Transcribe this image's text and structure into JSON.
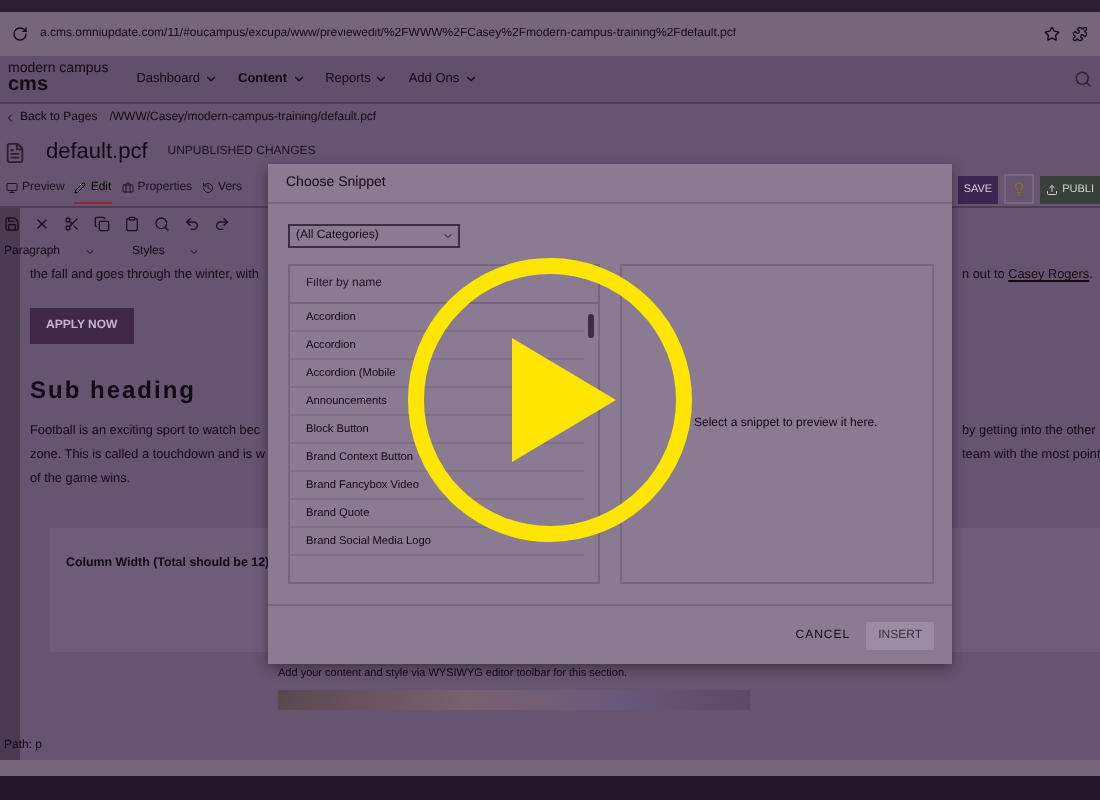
{
  "browser": {
    "url": "a.cms.omniupdate.com/11/#oucampus/excupa/www/previewedit/%2FWWW%2FCasey%2Fmodern-campus-training%2Fdefault.pcf"
  },
  "header": {
    "logo_top": "modern campus",
    "logo_bottom": "cms",
    "nav": [
      {
        "label": "Dashboard",
        "selected": false
      },
      {
        "label": "Content",
        "selected": true
      },
      {
        "label": "Reports",
        "selected": false
      },
      {
        "label": "Add Ons",
        "selected": false
      }
    ]
  },
  "breadcrumb": {
    "back": "Back to Pages",
    "path": "/WWW/Casey/modern-campus-training/default.pcf"
  },
  "page": {
    "title": "default.pcf",
    "status": "UNPUBLISHED CHANGES"
  },
  "tabs": [
    {
      "label": "Preview",
      "kind": "preview",
      "selected": false
    },
    {
      "label": "Edit",
      "kind": "edit",
      "selected": true
    },
    {
      "label": "Properties",
      "kind": "properties",
      "selected": false
    },
    {
      "label": "Vers",
      "kind": "versions",
      "selected": false
    }
  ],
  "actions": {
    "save": "SAVE",
    "publish": "PUBLI"
  },
  "format": {
    "block": "Paragraph",
    "styles": "Styles"
  },
  "content": {
    "line_1": "the fall and goes through the winter, with",
    "line_1_right": {
      "text": "n out to ",
      "link": "Casey Rogers",
      "after": "."
    },
    "button": "APPLY NOW",
    "heading": "Sub heading",
    "para_left": [
      "Football is an exciting sport to watch bec",
      "zone. This is called a touchdown and is w",
      "of the game wins."
    ],
    "para_right": [
      "by getting into the other",
      "team with the most point"
    ],
    "column_label": "Column Width (Total should be 12)",
    "hint": "Add your content and style via WYSIWYG editor toolbar for this section."
  },
  "path": "Path: p",
  "modal": {
    "title": "Choose Snippet",
    "category": "(All Categories)",
    "filter_placeholder": "Filter by name",
    "items": [
      "Accordion",
      "Accordion",
      "Accordion (Mobile",
      "Announcements",
      "Block Button",
      "Brand Context Button",
      "Brand Fancybox Video",
      "Brand Quote",
      "Brand Social Media Logo"
    ],
    "preview_text": "Select a snippet to preview it here.",
    "cancel": "CANCEL",
    "insert": {
      "label": "INSERT",
      "disabled": true
    }
  }
}
